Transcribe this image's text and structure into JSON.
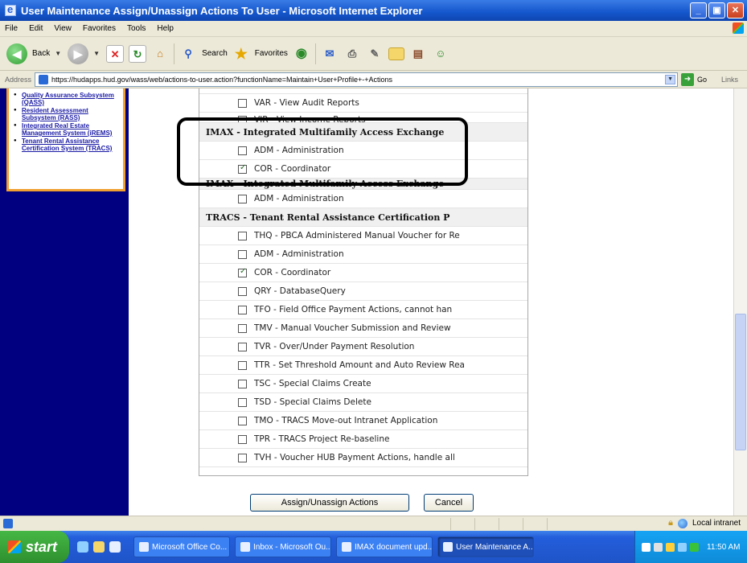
{
  "window": {
    "title": "User Maintenance Assign/Unassign Actions To User - Microsoft Internet Explorer",
    "minimize": "_",
    "maximize": "▣",
    "close": "✕"
  },
  "menu": [
    "File",
    "Edit",
    "View",
    "Favorites",
    "Tools",
    "Help"
  ],
  "toolbar": {
    "back": "Back",
    "search": "Search",
    "favorites": "Favorites"
  },
  "address": {
    "label": "Address",
    "url": "https://hudapps.hud.gov/wass/web/actions-to-user.action?functionName=Maintain+User+Profile+-+Actions",
    "go": "Go",
    "links": "Links"
  },
  "sidebar": {
    "items": [
      "Quality Assurance Subsystem (QASS)",
      "Resident Assessment Subsystem (RASS)",
      "Integrated Real Estate Management System (iREMS)",
      "Tenant Rental Assistance Certification System (TRACS)"
    ]
  },
  "actions": {
    "top_items": [
      {
        "label": "VAR - View Audit Reports",
        "checked": false
      },
      {
        "label": "VIR - View Income Reports",
        "checked": false
      }
    ],
    "imax": {
      "header": "IMAX - Integrated Multifamily Access Exchange",
      "items": [
        {
          "label": "ADM - Administration",
          "checked": false
        },
        {
          "label": "COR - Coordinator",
          "checked": true
        }
      ]
    },
    "imax2": {
      "header": "IMAX - Integrated Multifamily Access Exchange",
      "items": [
        {
          "label": "ADM - Administration",
          "checked": false
        }
      ]
    },
    "tracs": {
      "header": "TRACS - Tenant Rental Assistance Certification P",
      "items": [
        {
          "label": "THQ - PBCA Administered Manual Voucher for Re",
          "checked": false
        },
        {
          "label": "ADM - Administration",
          "checked": false
        },
        {
          "label": "COR - Coordinator",
          "checked": true
        },
        {
          "label": "QRY - DatabaseQuery",
          "checked": false
        },
        {
          "label": "TFO - Field Office Payment Actions, cannot han",
          "checked": false
        },
        {
          "label": "TMV - Manual Voucher Submission and Review",
          "checked": false
        },
        {
          "label": "TVR - Over/Under Payment Resolution",
          "checked": false
        },
        {
          "label": "TTR - Set Threshold Amount and Auto Review Rea",
          "checked": false
        },
        {
          "label": "TSC - Special Claims Create",
          "checked": false
        },
        {
          "label": "TSD - Special Claims Delete",
          "checked": false
        },
        {
          "label": "TMO - TRACS Move-out Intranet Application",
          "checked": false
        },
        {
          "label": "TPR - TRACS Project Re-baseline",
          "checked": false
        },
        {
          "label": "TVH - Voucher HUB Payment Actions, handle all",
          "checked": false
        }
      ]
    }
  },
  "buttons": {
    "assign": "Assign/Unassign Actions",
    "cancel": "Cancel"
  },
  "status": {
    "zone": "Local intranet"
  },
  "taskbar": {
    "start": "start",
    "tasks": [
      "Microsoft Office Co...",
      "Inbox - Microsoft Ou...",
      "IMAX document upd...",
      "User Maintenance A..."
    ],
    "clock": "11:50 AM"
  },
  "colors": {
    "nav_background": "#000080",
    "nav_border": "#f0a030",
    "title_bar": "#1456cc",
    "highlight_box": "#000000"
  }
}
